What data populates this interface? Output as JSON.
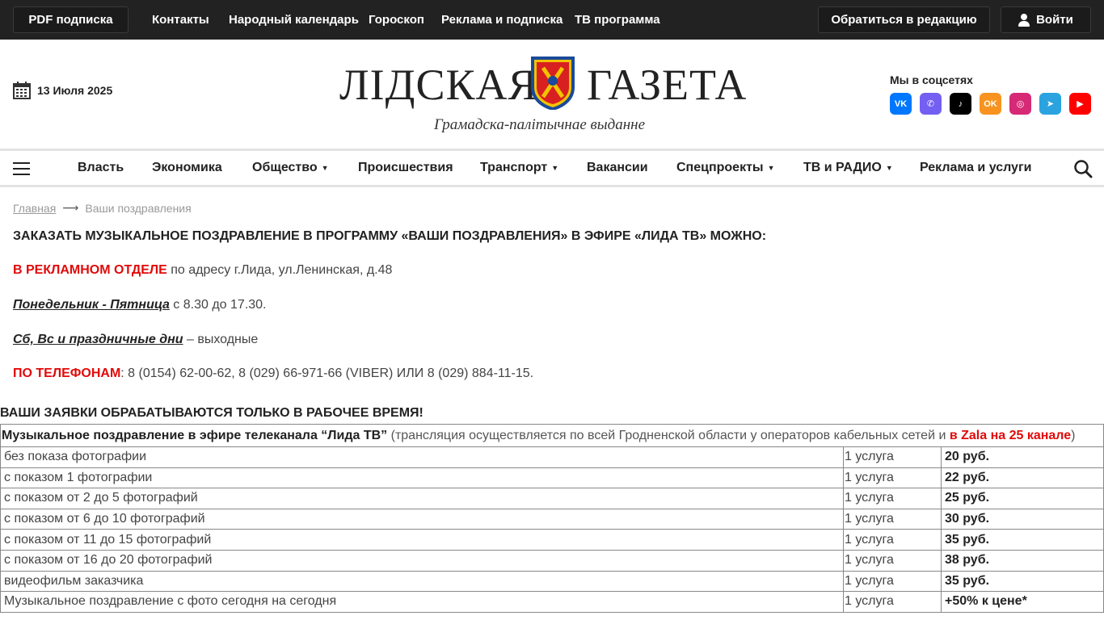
{
  "topbar": {
    "pdf": "PDF подписка",
    "links": [
      "Контакты",
      "Народный календарь",
      "Гороскоп",
      "Реклама и подписка",
      "ТВ программа"
    ],
    "editorial": "Обратиться в редакцию",
    "login": "Войти"
  },
  "header": {
    "date": "13 Июля 2025",
    "logo_left": "ЛІДСКАЯ",
    "logo_right": "ГАЗЕТА",
    "tagline": "Грамадска-палітычнае выданне",
    "social_title": "Мы в соцсетях",
    "socials": [
      {
        "name": "vk-icon",
        "color": "#0077ff",
        "glyph": "VK"
      },
      {
        "name": "viber-icon",
        "color": "#7360f2",
        "glyph": "✆"
      },
      {
        "name": "tiktok-icon",
        "color": "#000000",
        "glyph": "♪"
      },
      {
        "name": "odnoklassniki-icon",
        "color": "#f7931e",
        "glyph": "OK"
      },
      {
        "name": "instagram-icon",
        "color": "#d62976",
        "glyph": "◎"
      },
      {
        "name": "telegram-icon",
        "color": "#2aa3e0",
        "glyph": "➤"
      },
      {
        "name": "youtube-icon",
        "color": "#ff0000",
        "glyph": "▶"
      }
    ]
  },
  "nav": {
    "items": [
      "Власть",
      "Экономика",
      "Общество",
      "Происшествия",
      "Транспорт",
      "Вакансии",
      "Спецпроекты",
      "ТВ и РАДИО",
      "Реклама и услуги"
    ],
    "dropdown_caret": "▼"
  },
  "breadcrumb": {
    "home": "Главная",
    "arrow": "⟶",
    "current": "Ваши поздравления"
  },
  "content": {
    "heading": "ЗАКАЗАТЬ МУЗЫКАЛЬНОЕ ПОЗДРАВЛЕНИЕ В ПРОГРАММУ «ВАШИ ПОЗДРАВЛЕНИЯ» В ЭФИРЕ «ЛИДА ТВ» МОЖНО:",
    "ad_dept_label": "В РЕКЛАМНОМ ОТДЕЛЕ",
    "ad_dept_text": " по адресу г.Лида, ул.Ленинская, д.48",
    "weekdays_label": "Понедельник - Пятница",
    "weekdays_text": " с 8.30 до 17.30.",
    "weekend_label": "Сб, Вс и праздничные дни",
    "weekend_text": " – выходные",
    "phone_label": "ПО ТЕЛЕФОНАМ",
    "phone_text": ": 8 (0154) 62-00-62, 8 (029) 66-971-66 (VIBER) ИЛИ 8 (029) 884-11-15.",
    "notice": "ВАШИ ЗАЯВКИ ОБРАБАТЫВАЮТСЯ ТОЛЬКО В РАБОЧЕЕ ВРЕМЯ!"
  },
  "prices": {
    "head_bold": "Музыкальное поздравление в эфире телеканала “Лида ТВ”",
    "head_text": " (трансляция осуществляется по всей Гродненской области у операторов кабельных сетей и ",
    "head_red": "в Zala на 25 канале",
    "head_close": ")",
    "rows": [
      {
        "service": "без показа фотографии",
        "unit": "1 услуга",
        "price": "20 руб."
      },
      {
        "service": "с показом 1 фотографии",
        "unit": "1 услуга",
        "price": "22 руб."
      },
      {
        "service": "с показом от 2 до 5 фотографий",
        "unit": "1 услуга",
        "price": "25 руб."
      },
      {
        "service": "с показом от 6 до 10 фотографий",
        "unit": "1 услуга",
        "price": "30 руб."
      },
      {
        "service": "с показом от 11 до 15 фотографий",
        "unit": "1 услуга",
        "price": "35 руб."
      },
      {
        "service": "с показом от 16 до 20 фотографий",
        "unit": "1 услуга",
        "price": "38 руб."
      },
      {
        "service": "видеофильм заказчика",
        "unit": "1 услуга",
        "price": "35 руб."
      },
      {
        "service": "Музыкальное поздравление с фото сегодня на сегодня",
        "unit": "1 услуга",
        "price": "+50% к цене*"
      }
    ]
  }
}
